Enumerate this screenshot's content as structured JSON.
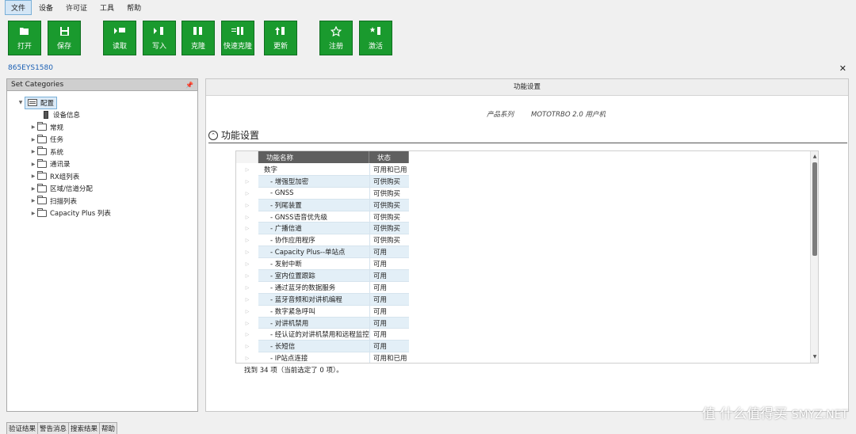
{
  "menu": [
    "文件",
    "设备",
    "许可证",
    "工具",
    "帮助"
  ],
  "toolbar": [
    {
      "label": "打开",
      "icon": "folder-open-icon"
    },
    {
      "label": "保存",
      "icon": "save-icon"
    },
    {
      "label": "读取",
      "icon": "read-icon"
    },
    {
      "label": "写入",
      "icon": "write-icon"
    },
    {
      "label": "克隆",
      "icon": "clone-icon"
    },
    {
      "label": "快速克隆",
      "icon": "quick-clone-icon"
    },
    {
      "label": "更新",
      "icon": "update-icon"
    },
    {
      "label": "注册",
      "icon": "star-icon"
    },
    {
      "label": "激活",
      "icon": "activate-icon"
    }
  ],
  "device_id": "865EYS1580",
  "left_panel": {
    "title": "Set Categories",
    "root": "配置",
    "device_info": "设备信息",
    "categories": [
      "常规",
      "任务",
      "系统",
      "通讯录",
      "RX组列表",
      "区域/信道分配",
      "扫描列表",
      "Capacity Plus 列表"
    ]
  },
  "right_panel": {
    "title": "功能设置",
    "product_label": "产品系列",
    "product_value": "MOTOTRBO 2.0 用户机",
    "section": "功能设置",
    "columns": [
      "功能名称",
      "状态"
    ],
    "rows": [
      {
        "name": "数字",
        "status": "可用和已用",
        "indent": false
      },
      {
        "name": "- 增强型加密",
        "status": "可供购买",
        "indent": true
      },
      {
        "name": "- GNSS",
        "status": "可供购买",
        "indent": true
      },
      {
        "name": "- 列尾装置",
        "status": "可供购买",
        "indent": true
      },
      {
        "name": "- GNSS语音优先级",
        "status": "可供购买",
        "indent": true
      },
      {
        "name": "- 广播信道",
        "status": "可供购买",
        "indent": true
      },
      {
        "name": "- 协作应用程序",
        "status": "可供购买",
        "indent": true
      },
      {
        "name": "- Capacity Plus--单站点",
        "status": "可用",
        "indent": true
      },
      {
        "name": "- 发射中断",
        "status": "可用",
        "indent": true
      },
      {
        "name": "- 室内位置跟踪",
        "status": "可用",
        "indent": true
      },
      {
        "name": "- 通过蓝牙的数据服务",
        "status": "可用",
        "indent": true
      },
      {
        "name": "- 蓝牙音频和对讲机编程",
        "status": "可用",
        "indent": true
      },
      {
        "name": "- 数字紧急呼叫",
        "status": "可用",
        "indent": true
      },
      {
        "name": "- 对讲机禁用",
        "status": "可用",
        "indent": true
      },
      {
        "name": "- 经认证的对讲机禁用和远程监控",
        "status": "可用",
        "indent": true
      },
      {
        "name": "- 长短信",
        "status": "可用",
        "indent": true
      },
      {
        "name": "- IP站点连接",
        "status": "可用和已用",
        "indent": true
      }
    ],
    "found_text": "找到 34 项（当前选定了 0 项）。"
  },
  "bottom_tabs": [
    "验证结果",
    "警告消息",
    "搜索结果",
    "帮助"
  ],
  "watermark": "值 什么值得买",
  "watermark_site": "SMYZ.NET",
  "colors": {
    "toolbar_green": "#1a9a2e",
    "header_dark": "#5f5f5f",
    "row_alt": "#e3eff7",
    "link_blue": "#1a5fb4"
  }
}
